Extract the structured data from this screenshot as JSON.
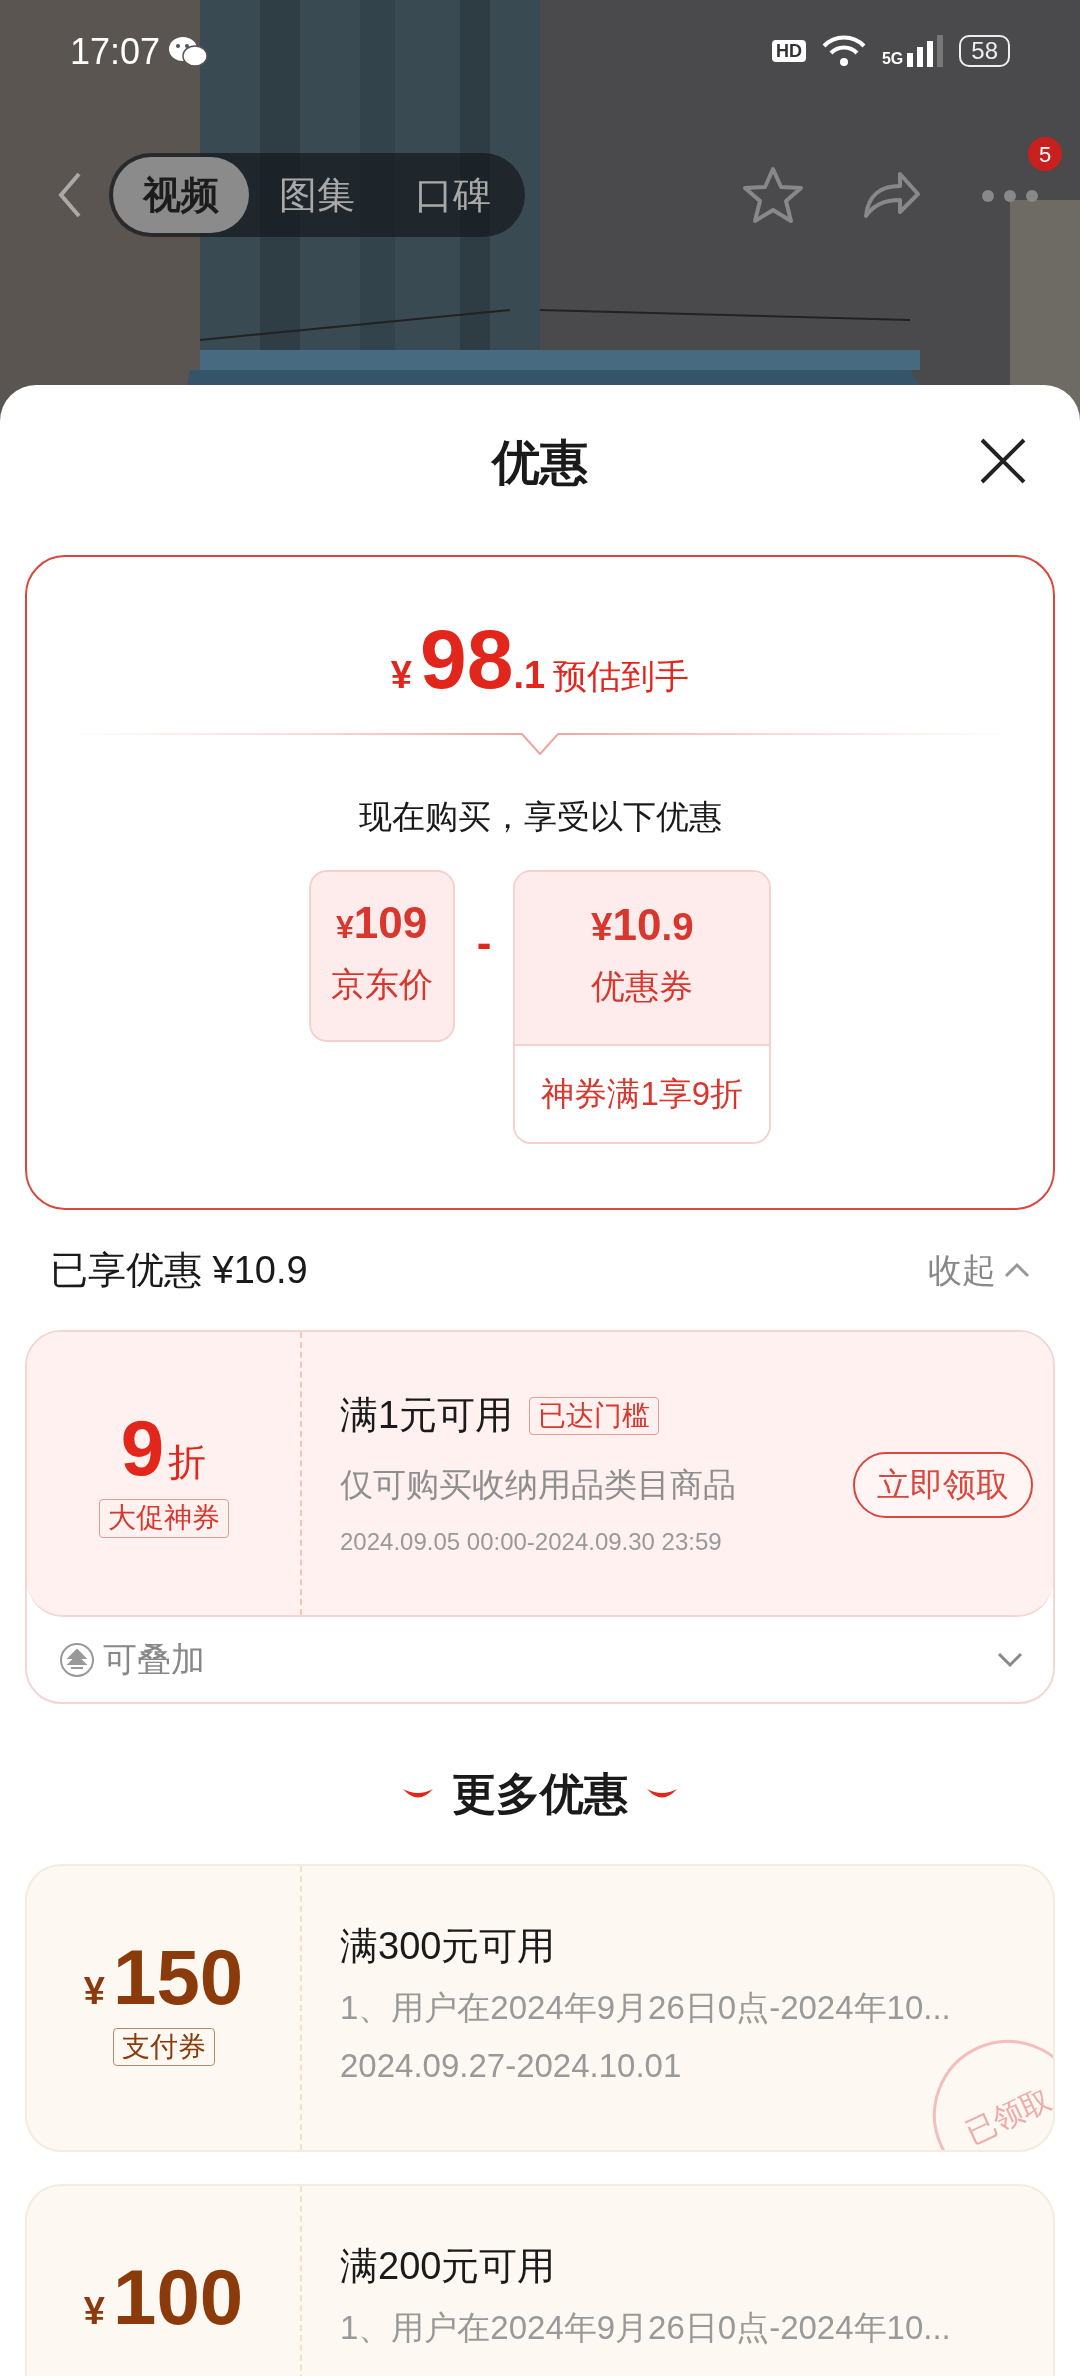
{
  "status_bar": {
    "time": "17:07",
    "hd": "HD",
    "network": "5G",
    "battery": "58"
  },
  "nav": {
    "tabs": [
      {
        "label": "视频",
        "selected": true
      },
      {
        "label": "图集",
        "selected": false
      },
      {
        "label": "口碑",
        "selected": false
      }
    ],
    "more_badge": "5"
  },
  "sheet": {
    "title": "优惠"
  },
  "estimate": {
    "currency": "¥",
    "integer": "98",
    "decimal": ".1",
    "label": "预估到手",
    "subtitle": "现在购买，享受以下优惠",
    "price": {
      "currency": "¥",
      "amount": "109",
      "label": "京东价"
    },
    "operator": "-",
    "coupon": {
      "currency": "¥",
      "amount": "10",
      "decimal": ".9",
      "label": "优惠券",
      "note": "神券满1享9折"
    }
  },
  "applied": {
    "title": "已享优惠 ¥10.9",
    "toggle": "收起",
    "expanded": true,
    "coupons": [
      {
        "value": "9",
        "unit": "折",
        "tag": "大促神券",
        "condition": "满1元可用",
        "badge": "已达门槛",
        "scope": "仅可购买收纳用品类目商品",
        "validity": "2024.09.05 00:00-2024.09.30 23:59",
        "action": "立即领取",
        "stack": "可叠加",
        "stack_expanded": false
      }
    ]
  },
  "more": {
    "title": "更多优惠",
    "coupons": [
      {
        "currency": "¥",
        "amount": "150",
        "tag": "支付券",
        "condition": "满300元可用",
        "description": "1、用户在2024年9月26日0点-2024年10...",
        "validity": "2024.09.27-2024.10.01",
        "stamp": "已领取"
      },
      {
        "currency": "¥",
        "amount": "100",
        "condition": "满200元可用",
        "description": "1、用户在2024年9月26日0点-2024年10..."
      }
    ]
  }
}
